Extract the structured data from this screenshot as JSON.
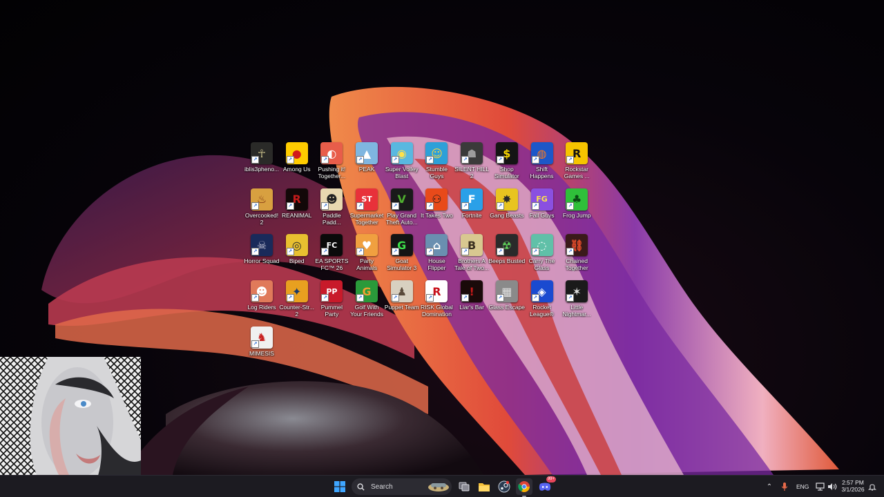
{
  "desktop": {
    "icons": [
      {
        "label": "iblis3pheno...",
        "bg": "#2a2a28",
        "fg": "#c9c08a",
        "glyph": "☥"
      },
      {
        "label": "Among Us",
        "bg": "#ffcc00",
        "fg": "#d21a1a",
        "glyph": "●"
      },
      {
        "label": "Pushing it!\nTogether...",
        "bg": "#e85d4a",
        "fg": "#ffffff",
        "glyph": "◐"
      },
      {
        "label": "PEAK",
        "bg": "#7fb6e0",
        "fg": "#ffffff",
        "glyph": "▲"
      },
      {
        "label": "Super Volley\nBlast",
        "bg": "#59b8e0",
        "fg": "#ffe14a",
        "glyph": "◉"
      },
      {
        "label": "Stumble\nGuys",
        "bg": "#2da0d8",
        "fg": "#ffd23a",
        "glyph": "☺"
      },
      {
        "label": "SILENT HILL\n2",
        "bg": "#3a3a3a",
        "fg": "#9c9c9c",
        "glyph": "☗"
      },
      {
        "label": "Shop\nSimulator",
        "bg": "#141414",
        "fg": "#f5d400",
        "glyph": "$"
      },
      {
        "label": "Shift\nHappens",
        "bg": "#1d57c8",
        "fg": "#ff7a1a",
        "glyph": "◍"
      },
      {
        "label": "Rockstar\nGames ...",
        "bg": "#f6c400",
        "fg": "#111111",
        "glyph": "R"
      },
      {
        "label": "Overcooked!\n2",
        "bg": "#d8a040",
        "fg": "#7a2e10",
        "glyph": "♨"
      },
      {
        "label": "REANIMAL",
        "bg": "#120808",
        "fg": "#c01a1a",
        "glyph": "R"
      },
      {
        "label": "Paddle\nPadd...",
        "bg": "#e8d8b0",
        "fg": "#222222",
        "glyph": "☻"
      },
      {
        "label": "Supermarket\nTogether",
        "bg": "#e8313a",
        "fg": "#ffffff",
        "glyph": "ST"
      },
      {
        "label": "Play Grand\nTheft Auto...",
        "bg": "#1a1a1a",
        "fg": "#4fae2f",
        "glyph": "V"
      },
      {
        "label": "It Takes Two",
        "bg": "#e84a1a",
        "fg": "#1a1a1a",
        "glyph": "⚇"
      },
      {
        "label": "Fortnite",
        "bg": "#2aa0e8",
        "fg": "#ffffff",
        "glyph": "F"
      },
      {
        "label": "Gang Beasts",
        "bg": "#e8c420",
        "fg": "#2a2a2a",
        "glyph": "✸"
      },
      {
        "label": "Fall Guys",
        "bg": "#8a50e0",
        "fg": "#ffe24a",
        "glyph": "FG"
      },
      {
        "label": "Frog Jump",
        "bg": "#2fbf3a",
        "fg": "#0a4a14",
        "glyph": "♣"
      },
      {
        "label": "Horror Squad",
        "bg": "#1a2a5a",
        "fg": "#c7c7d8",
        "glyph": "☠"
      },
      {
        "label": "Biped",
        "bg": "#e8c030",
        "fg": "#2a2a2a",
        "glyph": "◎"
      },
      {
        "label": "EA SPORTS\nFC™ 26",
        "bg": "#0a0a0a",
        "fg": "#ffffff",
        "glyph": "FC"
      },
      {
        "label": "Party\nAnimals",
        "bg": "#f0a040",
        "fg": "#ffffff",
        "glyph": "♥"
      },
      {
        "label": "Goat\nSimulator 3",
        "bg": "#141414",
        "fg": "#3de04a",
        "glyph": "G"
      },
      {
        "label": "House\nFlipper",
        "bg": "#6a8fb0",
        "fg": "#ffffff",
        "glyph": "⌂"
      },
      {
        "label": "Brothers A\nTale of Two...",
        "bg": "#d8c890",
        "fg": "#3a3020",
        "glyph": "B"
      },
      {
        "label": "Beeps Busted",
        "bg": "#2a2a2a",
        "fg": "#5fd05a",
        "glyph": "☢"
      },
      {
        "label": "Carry The\nGlass",
        "bg": "#60c0a8",
        "fg": "#ffffff",
        "glyph": "◌"
      },
      {
        "label": "Chained\nTogether",
        "bg": "#3a1a1a",
        "fg": "#e04a2a",
        "glyph": "⛓"
      },
      {
        "label": "Log Riders",
        "bg": "#e07a5a",
        "fg": "#ffffff",
        "glyph": "☻"
      },
      {
        "label": "Counter-Str...\n2",
        "bg": "#e8a020",
        "fg": "#1a3a6a",
        "glyph": "✦"
      },
      {
        "label": "Pummel\nParty",
        "bg": "#c81a2a",
        "fg": "#ffffff",
        "glyph": "PP"
      },
      {
        "label": "Golf With\nYour Friends",
        "bg": "#2a9a3a",
        "fg": "#f0a030",
        "glyph": "G"
      },
      {
        "label": "Puppet Team",
        "bg": "#d8d0c0",
        "fg": "#5a4a3a",
        "glyph": "♟"
      },
      {
        "label": "RISK Global\nDomination",
        "bg": "#ffffff",
        "fg": "#c8101a",
        "glyph": "R"
      },
      {
        "label": "Liar's Bar",
        "bg": "#1a0a0a",
        "fg": "#c81a1a",
        "glyph": "!"
      },
      {
        "label": "Glass Escape",
        "bg": "#8a8a8a",
        "fg": "#e0e0e0",
        "glyph": "▦"
      },
      {
        "label": "Rocket\nLeague®",
        "bg": "#1a4ad0",
        "fg": "#ffffff",
        "glyph": "◈"
      },
      {
        "label": "Little\nNightmar...",
        "bg": "#1a1a1a",
        "fg": "#e0e0e0",
        "glyph": "✶"
      },
      {
        "label": "MIMESIS",
        "bg": "#f0f0f0",
        "fg": "#c82020",
        "glyph": "♞"
      }
    ]
  },
  "webcam": {
    "description_icon": "webcam-overlay"
  },
  "taskbar": {
    "search_label": "Search",
    "language": "ENG",
    "time": "2:57 PM",
    "date": "3/1/2026",
    "discord_badge": "99+"
  }
}
